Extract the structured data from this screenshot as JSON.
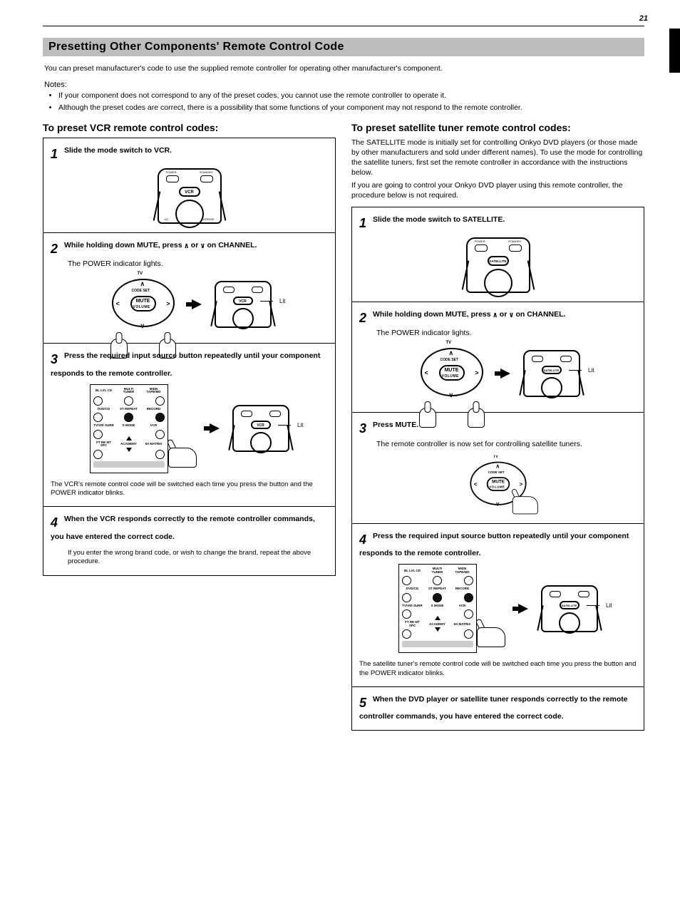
{
  "page_number": "21",
  "section_bar": "Presetting Other Components' Remote Control Code",
  "intro": "You can preset manufacturer's code to use the supplied remote controller for operating other manufacturer's component.",
  "notes_title": "Notes:",
  "notes": [
    "If your component does not correspond to any of the preset codes, you cannot use the remote controller to operate it.",
    "Although the preset codes are correct, there is a possibility that some functions of your component may not respond to the remote controller."
  ],
  "left": {
    "title": "To preset VCR remote control codes:",
    "steps": {
      "s1": {
        "num": "1",
        "text_a": "Slide the mode switch to VCR."
      },
      "s2": {
        "num": "2",
        "text_a": "While holding down MUTE, press ",
        "text_b": " or ",
        "text_c": " on CHANNEL.",
        "lit_note": "The POWER indicator lights."
      },
      "s3": {
        "num": "3",
        "text_a": "Press the required input source button repeatedly until your component responds to the remote controller.",
        "text_b": "The VCR's remote control code will be switched each time you press the button and the POWER indicator blinks."
      },
      "s4": {
        "num": "4",
        "text_a": "When the VCR responds correctly to the remote controller commands, you have entered the correct code.",
        "text_b": "If you enter the wrong brand code, or wish to change the brand, repeat the above procedure."
      }
    },
    "remote_labels": {
      "power": "POWER",
      "standby": "STANDBY",
      "mode": "VCR",
      "lit": "Lit",
      "bl": "CD",
      "br": "TAPE/MD"
    },
    "tv_ctrl": {
      "top": "TV",
      "codeset": "CODE SET",
      "mute": "MUTE",
      "volume": "VOLUME"
    },
    "grid": {
      "col1": [
        "BL LVL CD",
        "DVD/CD",
        "TV/VID SURR",
        "FT RE MT SPC"
      ],
      "col2": [
        "MULTI TUNER",
        "ST REPEAT",
        "S MODE",
        "ACADEMY"
      ],
      "col3": [
        "MIDN TAPE/MD",
        "RECORD",
        "VCR",
        "5X MATRIX"
      ]
    }
  },
  "right": {
    "title": "To preset satellite tuner remote control codes:",
    "pre": [
      "The SATELLITE mode is initially set for controlling Onkyo DVD players (or those made by other manufacturers and sold under different names). To use the mode for controlling the satellite tuners, first set the remote controller in accordance with the instructions below.",
      "If you are going to control your Onkyo DVD player using this remote controller, the procedure below is not required."
    ],
    "steps": {
      "s1": {
        "num": "1",
        "text_a": "Slide the mode switch to SATELLITE."
      },
      "s2": {
        "num": "2",
        "text_a": "While holding down MUTE, press ",
        "text_b": " or ",
        "text_c": " on CHANNEL.",
        "lit_note": "The POWER indicator lights."
      },
      "s3": {
        "num": "3",
        "text_a": "Press MUTE.",
        "text_b": "The remote controller is now set for controlling satellite tuners."
      },
      "s4": {
        "num": "4",
        "text_a": "Press the required input source button repeatedly until your component responds to the remote controller.",
        "text_b": "The satellite tuner's remote control code will be switched each time you press the button and the POWER indicator blinks."
      },
      "s5": {
        "num": "5",
        "text_a": "When the DVD player or satellite tuner responds correctly to the remote controller commands, you have entered the correct code."
      }
    },
    "remote_labels": {
      "power": "POWER",
      "standby": "STANDBY",
      "mode": "SATELLITE",
      "lit": "Lit"
    }
  }
}
